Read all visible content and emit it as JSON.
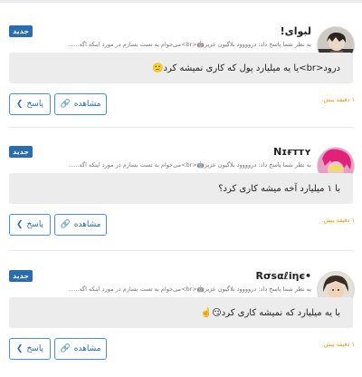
{
  "badge_label": "جدید",
  "reply_label": "پاسخ",
  "view_label": "مشاهده",
  "reply_icon": "chevron-right-icon",
  "view_icon": "link-icon",
  "notifications": [
    {
      "username": "لبوای!",
      "subline": "به نظر شما پاسخ داد: دروووود بلاگیون عزیز🤖<br>می‌خوام به تست بسازم در مورد اینکه اگه......",
      "message": "درود<br>یا یه میلیارد پول که کاری نمیشه کرد🙂",
      "time": "۱ دقیقه پیش."
    },
    {
      "username": "Nɪғᴛᴛʏ",
      "subline": "به نظر شما پاسخ داد: دروووود بلاگیون عزیز🤖<br>می‌خوام به تست بسازم در مورد اینکه اگه......",
      "message": "با ۱ میلیارد آخه میشه کاری کرد؟",
      "time": "۱ دقیقه پیش."
    },
    {
      "username": "•Rσsαℓiηє",
      "subline": "به نظر شما پاسخ داد: دروووود بلاگیون عزیز🤖<br>می‌خوام به تست بسازم در مورد اینکه اگه......",
      "message": "با یه میلیارد که نمیشه کاری کرد😏☝️",
      "time": "۱ دقیقه پیش."
    }
  ]
}
